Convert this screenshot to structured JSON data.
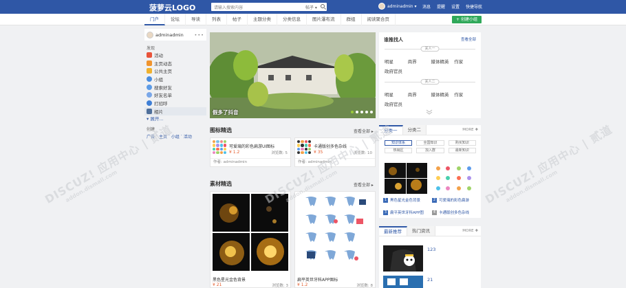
{
  "header": {
    "logo": "菠萝云LOGO",
    "search_placeholder": "请输入搜索内容",
    "search_scope": "帖子 ▾",
    "username": "adminadmin ▾",
    "links": [
      "消息",
      "提醒",
      "设置",
      "快捷导航"
    ]
  },
  "nav": {
    "items": [
      "门户",
      "论坛",
      "导读",
      "列表",
      "帖子",
      "主题分类",
      "分类信息",
      "图片瀑布流",
      "群组",
      "阅读聚合页"
    ],
    "create_label": "+ 创建小组"
  },
  "sidebar": {
    "username": "adminadmin",
    "menu_dots": "•••",
    "discover_title": "发现",
    "items": [
      "活动",
      "主页动态",
      "公共主页",
      "小组",
      "搜索好友",
      "好友名单",
      "打招呼",
      "相片"
    ],
    "expand": "▾ 展开...",
    "create_title": "创建",
    "create_links": [
      "广告",
      "·",
      "主页",
      "·",
      "小组",
      "·",
      "活动"
    ]
  },
  "slider": {
    "caption": "假多了抖音",
    "dot_count": 5
  },
  "finder": {
    "title": "谁推找人",
    "view_all": "查看全部",
    "groups": [
      {
        "label": "关人一",
        "items": [
          "明星",
          "商界",
          "媒体精英",
          "作家",
          "政府官员"
        ]
      },
      {
        "label": "关人二",
        "items": [
          "明星",
          "商界",
          "媒体精英",
          "作家",
          "政府官员"
        ]
      }
    ]
  },
  "icons_section": {
    "title": "图标精选",
    "more": "查看全部 ▸",
    "cards": [
      {
        "name": "可爱璃的彩色扁游UI图标",
        "price": "¥ 1.2",
        "views": "浏览数: 5",
        "author": "作者: adminadmin"
      },
      {
        "name": "卡通版创多色杂线",
        "price": "¥ 35",
        "views": "浏览数: 10",
        "author": "作者: adminadmin"
      }
    ]
  },
  "category_card": {
    "tabs": [
      "分类一",
      "分类二"
    ],
    "more": "MORE ✚",
    "chips": [
      "知识体系",
      "全国知识",
      "购买知识",
      "热销区",
      "加入群",
      "最新知识"
    ],
    "items": [
      {
        "num": "1",
        "text": "黑色星光金色背景"
      },
      {
        "num": "2",
        "text": "可爱璃的彩色扁游"
      },
      {
        "num": "3",
        "text": "扁平英世牙科APP图"
      },
      {
        "num": "4",
        "text": "卡通版创多色杂线"
      }
    ]
  },
  "materials_section": {
    "title": "素材精选",
    "more": "查看全部 ▸",
    "cards": [
      {
        "name": "黑色星光金色背景",
        "price": "¥ 21",
        "views": "浏览数: 3"
      },
      {
        "name": "扁平英世牙科APP图标",
        "price": "¥ 1.2",
        "views": "浏览数: 8"
      }
    ]
  },
  "recommend_card": {
    "tabs": [
      "最新推荐",
      "热门资讯"
    ],
    "more": "MORE ✚",
    "items": [
      {
        "label": "123"
      },
      {
        "label": "21"
      }
    ]
  },
  "watermark": {
    "brand": "DISCUZ! 应用中心 | 贰道",
    "site": "addon.dismall.com"
  },
  "colors": {
    "topbar": "#2f57a6",
    "accent": "#2f57a6",
    "create_button": "#2fa85a",
    "price": "#e45b2a"
  }
}
